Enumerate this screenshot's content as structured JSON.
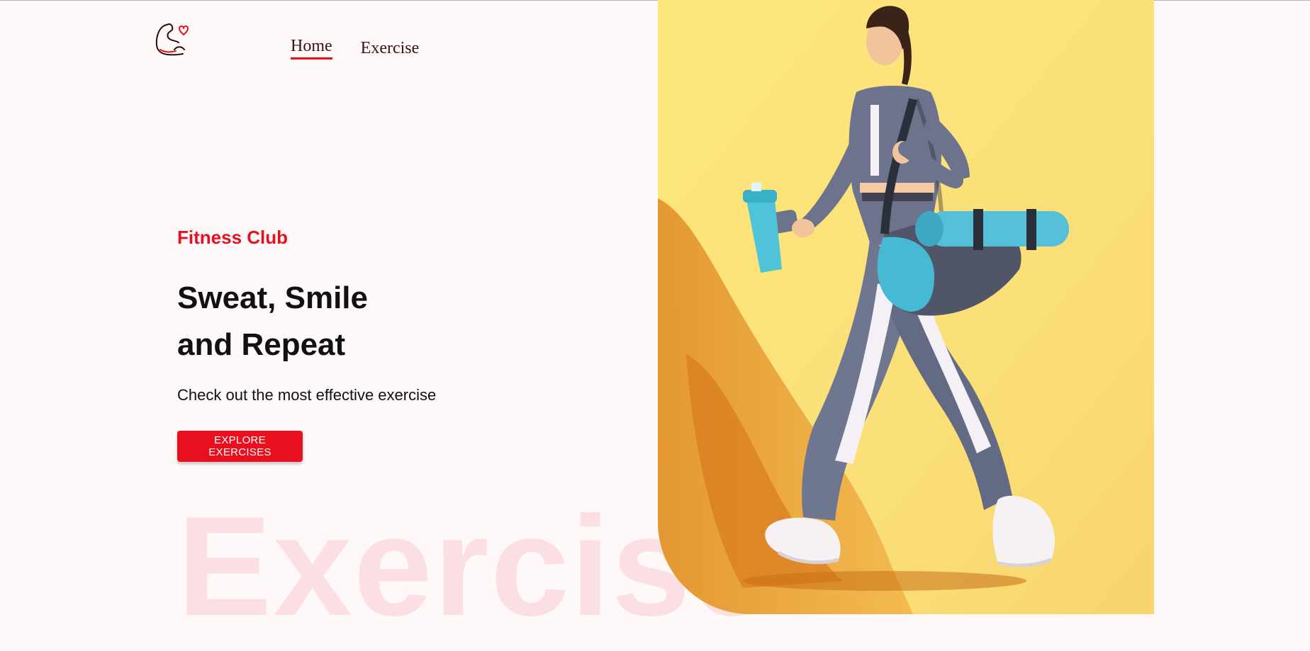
{
  "nav": {
    "logo_icon": "flexed-arm-heart-icon",
    "items": [
      {
        "label": "Home",
        "active": true
      },
      {
        "label": "Exercise",
        "active": false
      }
    ]
  },
  "hero": {
    "tagline": "Fitness Club",
    "headline_line1": "Sweat, Smile",
    "headline_line2": "and Repeat",
    "subtext": "Check out the most effective exercise",
    "cta_label": "EXPLORE EXERCISES",
    "background_word": "Exercise",
    "image": "woman-walking-with-gym-bag-and-shaker"
  },
  "colors": {
    "accent": "#e8101f",
    "page_bg": "#fff8f9",
    "watermark_text": "#fbdfe3",
    "image_bg": "#fbe27a"
  }
}
